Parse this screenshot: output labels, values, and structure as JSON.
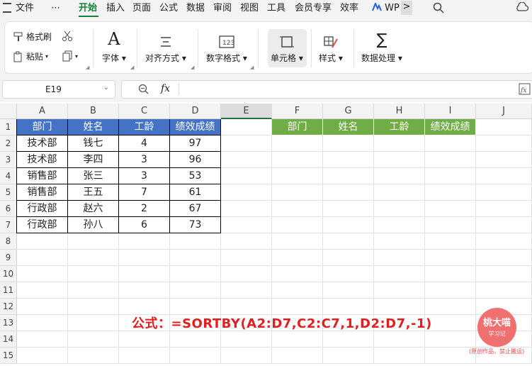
{
  "menubar": {
    "file": "文件",
    "more": "⋯",
    "tabs": [
      "开始",
      "插入",
      "页面",
      "公式",
      "数据",
      "审阅",
      "视图",
      "工具",
      "会员专享",
      "效率"
    ],
    "wps_ai": "WP",
    "chevron": ">"
  },
  "ribbon": {
    "format_painter": "格式刷",
    "paste": "粘贴",
    "font": "字体",
    "align": "对齐方式",
    "number_format": "数字格式",
    "cell": "单元格",
    "style": "样式",
    "data_process": "数据处理"
  },
  "formula_bar": {
    "name_box": "E19",
    "fx": "fx",
    "formula": ""
  },
  "sheet": {
    "columns": [
      "A",
      "B",
      "C",
      "D",
      "E",
      "F",
      "G",
      "H",
      "I",
      "J"
    ],
    "rows": [
      "1",
      "2",
      "3",
      "4",
      "5",
      "6",
      "7",
      "8",
      "9",
      "10",
      "11",
      "12",
      "13",
      "14",
      "15"
    ],
    "source_headers": [
      "部门",
      "姓名",
      "工龄",
      "绩效成绩"
    ],
    "source_rows": [
      [
        "技术部",
        "钱七",
        "4",
        "97"
      ],
      [
        "技术部",
        "李四",
        "3",
        "96"
      ],
      [
        "销售部",
        "张三",
        "3",
        "53"
      ],
      [
        "销售部",
        "王五",
        "7",
        "61"
      ],
      [
        "行政部",
        "赵六",
        "2",
        "67"
      ],
      [
        "行政部",
        "孙八",
        "6",
        "73"
      ]
    ],
    "target_headers": [
      "部门",
      "姓名",
      "工龄",
      "绩效成绩"
    ]
  },
  "annotation": {
    "formula_text": "公式：=SORTBY(A2:D7,C2:C7,1,D2:D7,-1)"
  },
  "watermark": {
    "name": "桃大喵",
    "sub": "学习记",
    "note": "(原创作品，禁止搬运)"
  },
  "colors": {
    "accent_green": "#1a7f37",
    "header_blue": "#4472c4",
    "header_green": "#70ad47",
    "annotation_red": "#e02020"
  }
}
